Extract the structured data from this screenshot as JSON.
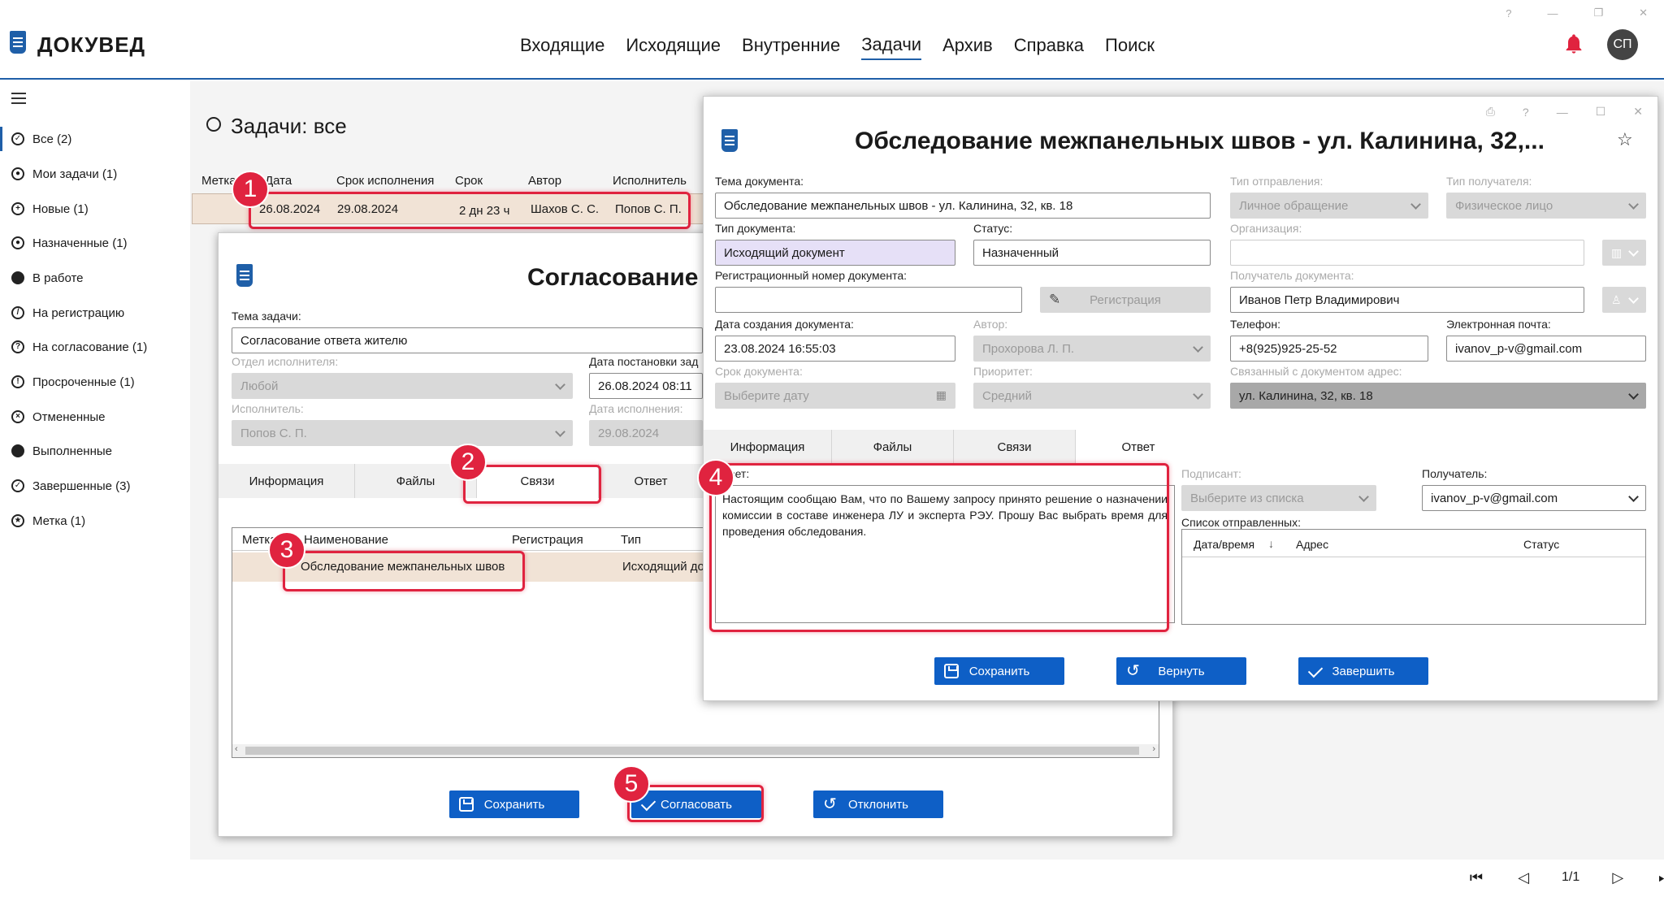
{
  "app": {
    "name": "ДОКУВЕД",
    "user_initials": "СП"
  },
  "nav": {
    "items": [
      "Входящие",
      "Исходящие",
      "Внутренние",
      "Задачи",
      "Архив",
      "Справка",
      "Поиск"
    ],
    "active": "Задачи"
  },
  "sidebar": {
    "items": [
      {
        "label": "Все (2)",
        "icon": "check-circle-icon"
      },
      {
        "label": "Мои задачи (1)",
        "icon": "user-circle-icon"
      },
      {
        "label": "Новые (1)",
        "icon": "plus-circle-icon"
      },
      {
        "label": "Назначенные (1)",
        "icon": "user-circle-icon"
      },
      {
        "label": "В работе",
        "icon": "filled-circle-icon"
      },
      {
        "label": "На регистрацию",
        "icon": "pen-circle-icon"
      },
      {
        "label": "На согласование (1)",
        "icon": "question-circle-icon"
      },
      {
        "label": "Просроченные (1)",
        "icon": "exclamation-circle-icon"
      },
      {
        "label": "Отмененные",
        "icon": "x-circle-icon"
      },
      {
        "label": "Выполненные",
        "icon": "half-circle-icon"
      },
      {
        "label": "Завершенные (3)",
        "icon": "check-circle-icon"
      },
      {
        "label": "Метка (1)",
        "icon": "star-circle-icon"
      }
    ]
  },
  "page": {
    "title": "Задачи: все"
  },
  "task_table": {
    "headers": [
      "Метка",
      "Дата",
      "Срок исполнения",
      "Срок",
      "Автор",
      "Исполнитель"
    ],
    "row": {
      "date": "26.08.2024",
      "due": "29.08.2024",
      "term": "2 дн 23 ч",
      "author": "Шахов С. С.",
      "executor": "Попов С. П."
    }
  },
  "task_dialog": {
    "title": "Согласование о",
    "theme_label": "Тема задачи:",
    "theme_value": "Согласование ответа жителю",
    "dept_label": "Отдел исполнителя:",
    "dept_value": "Любой",
    "executor_label": "Исполнитель:",
    "executor_value": "Попов С. П.",
    "posted_label": "Дата постановки зад",
    "posted_value": "26.08.2024 08:11",
    "done_label": "Дата исполнения:",
    "done_value": "29.08.2024",
    "tabs": [
      "Информация",
      "Файлы",
      "Связи",
      "Ответ"
    ],
    "links_headers": [
      "Метка",
      "Наименование",
      "Регистрация",
      "Тип"
    ],
    "links_row": {
      "name": "Обследование межпанельных швов",
      "type": "Исходящий до"
    },
    "buttons": {
      "save": "Сохранить",
      "approve": "Согласовать",
      "reject": "Отклонить"
    }
  },
  "doc_dialog": {
    "title": "Обследование межпанельных швов - ул. Калинина, 32,...",
    "theme_label": "Тема документа:",
    "theme_value": "Обследование межпанельных швов - ул. Калинина, 32, кв. 18",
    "type_label": "Тип документа:",
    "type_value": "Исходящий документ",
    "status_label": "Статус:",
    "status_value": "Назначенный",
    "regnum_label": "Регистрационный номер документа:",
    "reg_button": "Регистрация",
    "created_label": "Дата создания документа:",
    "created_value": "23.08.2024 16:55:03",
    "author_label": "Автор:",
    "author_value": "Прохорова Л. П.",
    "term_label": "Срок документа:",
    "term_placeholder": "Выберите дату",
    "priority_label": "Приоритет:",
    "priority_value": "Средний",
    "send_type_label": "Тип отправления:",
    "send_type_value": "Личное обращение",
    "recipient_type_label": "Тип получателя:",
    "recipient_type_value": "Физическое лицо",
    "org_label": "Организация:",
    "recipient_label": "Получатель документа:",
    "recipient_value": "Иванов Петр Владимирович",
    "phone_label": "Телефон:",
    "phone_value": "+8(925)925-25-52",
    "email_label": "Электронная почта:",
    "email_value": "ivanov_p-v@gmail.com",
    "address_label": "Связанный с документом адрес:",
    "address_value": "ул. Калинина, 32, кв. 18",
    "tabs": [
      "Информация",
      "Файлы",
      "Связи",
      "Ответ"
    ],
    "answer_label": "Ответ:",
    "answer_text": "Настоящим сообщаю Вам, что по Вашему запросу принято решение о назначении комиссии в составе инженера ЛУ и эксперта РЭУ. Прошу Вас выбрать время для проведения обследования.",
    "signer_label": "Подписант:",
    "signer_placeholder": "Выберите из списка",
    "to_label": "Получатель:",
    "to_value": "ivanov_p-v@gmail.com",
    "sent_list_label": "Список отправленных:",
    "sent_headers": [
      "Дата/время",
      "Адрес",
      "Статус"
    ],
    "buttons": {
      "save": "Сохранить",
      "return": "Вернуть",
      "finish": "Завершить"
    }
  },
  "badges": [
    "1",
    "2",
    "3",
    "4",
    "5"
  ],
  "pager": {
    "text": "1/1"
  },
  "colors": {
    "accent": "#0e5fc6",
    "highlight": "#e0233f",
    "row_selected": "#f1e3d6"
  }
}
